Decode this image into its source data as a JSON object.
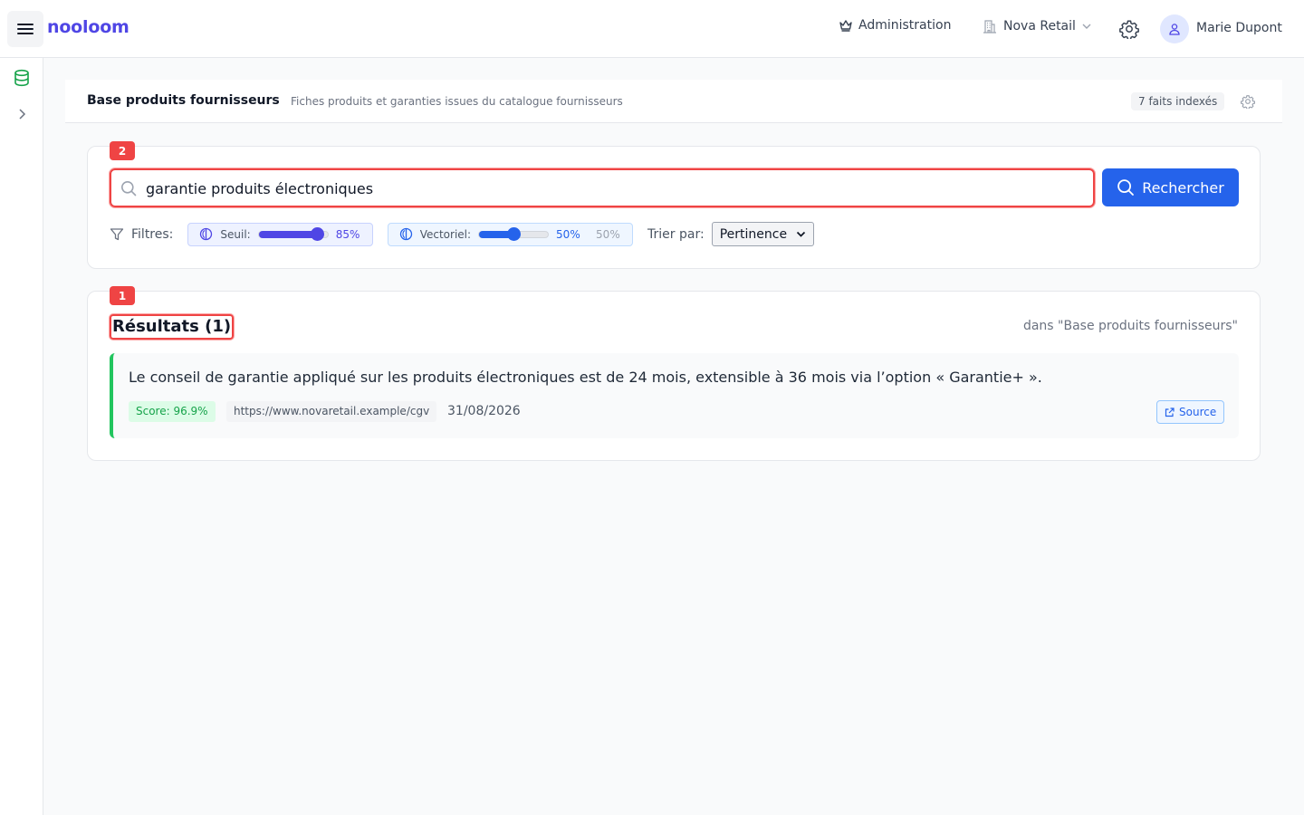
{
  "app": {
    "name": "nooloom"
  },
  "header": {
    "admin_label": "Administration",
    "org_label": "Nova Retail",
    "user_name": "Marie Dupont"
  },
  "knowledge_base": {
    "title": "Base produits fournisseurs",
    "description": "Fiches produits et garanties issues du catalogue fournisseurs",
    "badge": "7 faits indexés"
  },
  "search": {
    "marker": "2",
    "query": "garantie produits électroniques",
    "button_label": "Rechercher",
    "filters_label": "Filtres:",
    "threshold": {
      "label": "Seuil:",
      "value": 0.85,
      "display": "85%"
    },
    "vector": {
      "label": "Vectoriel:",
      "value": 0.5,
      "display": "50%",
      "display_alt": "50%"
    },
    "sort_label": "Trier par:",
    "sort_value": "Pertinence"
  },
  "results": {
    "marker": "1",
    "title": "Résultats (1)",
    "scope": "dans \"Base produits fournisseurs\"",
    "items": [
      {
        "text": "Le conseil de garantie appliqué sur les produits électroniques est de 24 mois, extensible à 36 mois via l’option « Garantie+ ».",
        "score": "Score: 96.9%",
        "url": "https://www.novaretail.example/cgv",
        "date": "31/08/2026",
        "source_label": "Source"
      }
    ]
  },
  "colors": {
    "brand": "#4f46e5",
    "primary": "#2563eb",
    "marker": "#ef4444",
    "success": "#22c55e",
    "threshold_slider": "#4f46e5",
    "vector_slider": "#2563eb"
  },
  "icons": {
    "menu": "hamburger-menu-icon",
    "admin": "crown-icon",
    "org": "building-icon",
    "settings": "gear-icon",
    "user": "user-icon",
    "database": "database-icon",
    "expand": "chevron-right-icon",
    "search": "search-icon",
    "filter": "filter-icon",
    "slider_mode": "contrast-circle-icon",
    "external": "external-link-icon"
  }
}
